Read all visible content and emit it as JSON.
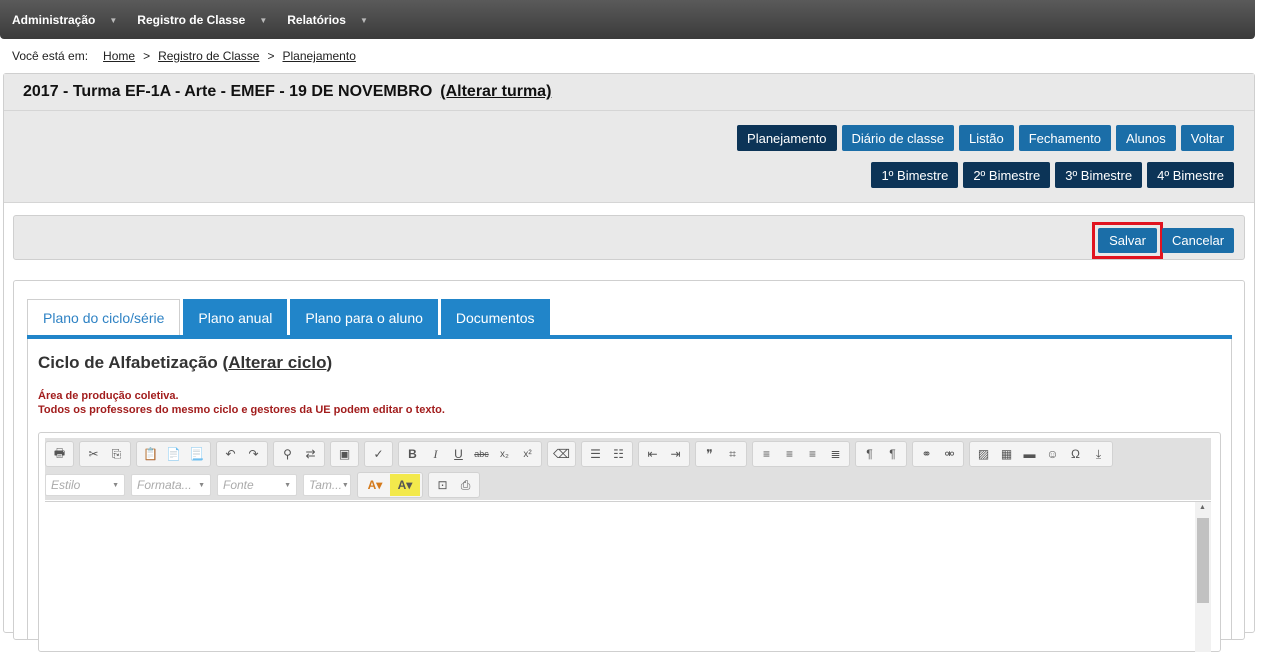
{
  "nav": {
    "items": [
      {
        "label": "Administração"
      },
      {
        "label": "Registro de Classe"
      },
      {
        "label": "Relatórios"
      }
    ],
    "caret": "▼"
  },
  "breadcrumb": {
    "prefix": "Você está em:",
    "items": [
      "Home",
      "Registro de Classe",
      "Planejamento"
    ],
    "sep": ">"
  },
  "header": {
    "title": "2017 - Turma EF-1A - Arte - EMEF - 19 DE NOVEMBRO",
    "change_link": "(Alterar turma)"
  },
  "buttons": {
    "row1": [
      "Planejamento",
      "Diário de classe",
      "Listão",
      "Fechamento",
      "Alunos",
      "Voltar"
    ],
    "row2": [
      "1º Bimestre",
      "2º Bimestre",
      "3º Bimestre",
      "4º Bimestre"
    ]
  },
  "actions": {
    "save": "Salvar",
    "cancel": "Cancelar"
  },
  "tabs": [
    "Plano do ciclo/série",
    "Plano anual",
    "Plano para o aluno",
    "Documentos"
  ],
  "content": {
    "cycle_title_prefix": "Ciclo de Alfabetização (",
    "cycle_change_link": "Alterar ciclo",
    "cycle_title_suffix": ")",
    "notice_line1": "Área de produção coletiva.",
    "notice_line2": "Todos os professores do mesmo ciclo e gestores da UE podem editar o texto."
  },
  "editor": {
    "combos": [
      "Estilo",
      "Formata...",
      "Fonte",
      "Tam..."
    ]
  },
  "colors": {
    "nav_bg": "#4a4a4a",
    "button_blue": "#1b6ea8",
    "button_dark": "#0c3457",
    "tab_blue": "#2185c9",
    "highlight_red": "#e1131f",
    "notice_red": "#a21d1d"
  }
}
